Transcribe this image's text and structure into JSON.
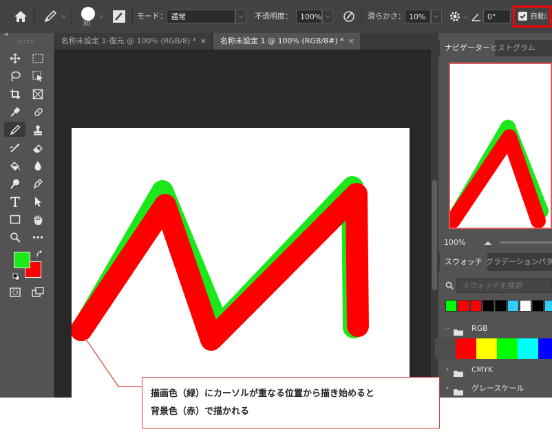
{
  "options_bar": {
    "home_icon": "home-icon",
    "brush_tool_icon": "pencil-icon",
    "brush_size": "30",
    "mode_label": "モード：",
    "mode_value": "通常",
    "opacity_label": "不透明度：",
    "opacity_value": "100%",
    "smoothing_label": "滑らかさ：",
    "smoothing_value": "10%",
    "angle_value": "0°",
    "auto_erase_label": "自動消去",
    "auto_erase_checked": true
  },
  "tabs": [
    {
      "label": "名称未設定 1-復元 @ 100% (RGB/8) *",
      "close": "×",
      "active": false
    },
    {
      "label": "名称未設定 1 @ 100% (RGB/8#) *",
      "close": "×",
      "active": true
    }
  ],
  "toolbar": {
    "collapse": "«",
    "foreground_color": "#1be81b",
    "background_color": "#ff0000"
  },
  "navigator_panel": {
    "tabs": [
      "ナビゲーター",
      "ヒストグラム"
    ],
    "zoom": "100%"
  },
  "swatches_panel": {
    "tabs": [
      "スウォッチ",
      "グラデーション",
      "パターン"
    ],
    "search_placeholder": "スウォッチを検索",
    "recent_colors": [
      "#00ff00",
      "#ff0000",
      "#ff0000",
      "#000000",
      "#000000",
      "#33ccff",
      "#ffffff",
      "#000000",
      "#33ccff"
    ],
    "groups": [
      {
        "name": "RGB",
        "expanded": true,
        "colors": [
          "#4d4d4d",
          "#ff0000",
          "#ffff00",
          "#00ff00",
          "#00ffff",
          "#0000ff"
        ]
      },
      {
        "name": "CMYK",
        "expanded": false
      },
      {
        "name": "グレースケール",
        "expanded": false
      }
    ]
  },
  "annotation": {
    "line1": "描画色（緑）にカーソルが重なる位置から描き始めると",
    "line2": "背景色（赤）で描かれる",
    "color": "#e03a3a"
  }
}
